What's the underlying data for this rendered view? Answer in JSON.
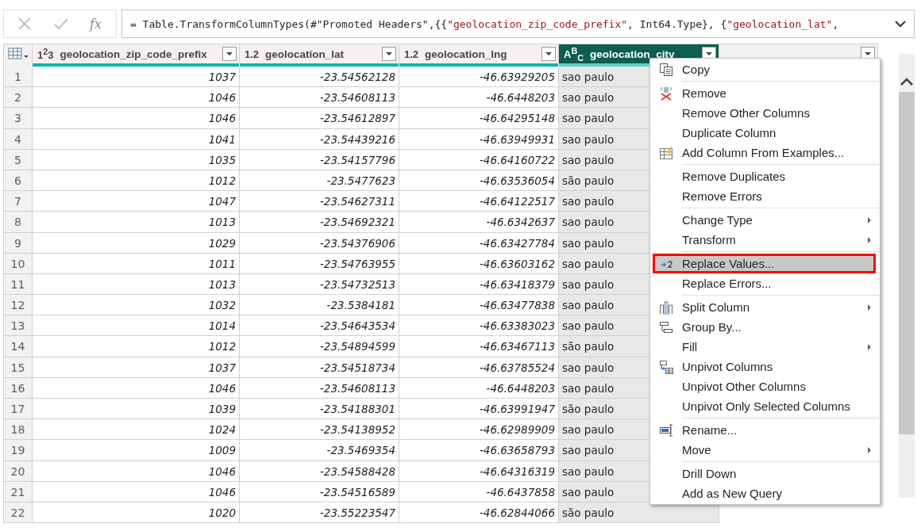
{
  "formula_bar": {
    "cancel_disabled": true,
    "commit_disabled": true,
    "fx": "fx",
    "formula": [
      {
        "kind": "code",
        "text": "= Table.TransformColumnTypes(#\"Promoted Headers\",{{"
      },
      {
        "kind": "string",
        "text": "\"geolocation_zip_code_prefix\""
      },
      {
        "kind": "code",
        "text": ", Int64.Type}, {"
      },
      {
        "kind": "string",
        "text": "\"geolocation_lat\""
      },
      {
        "kind": "code",
        "text": ","
      }
    ]
  },
  "table": {
    "columns": [
      {
        "type_label": "1$^{2}$3",
        "name": "geolocation_zip_code_prefix",
        "selected": false,
        "kind": "number"
      },
      {
        "type_label": "1.2",
        "name": "geolocation_lat",
        "selected": false,
        "kind": "number"
      },
      {
        "type_label": "1.2",
        "name": "geolocation_lng",
        "selected": false,
        "kind": "number"
      },
      {
        "type_label": "A$^{B}$$_{C}$",
        "name": "geolocation_city",
        "selected": true,
        "kind": "text"
      }
    ],
    "rows": [
      {
        "number": "1",
        "cells": [
          "1037",
          "-23.54562128",
          "-46.63929205",
          "sao paulo"
        ]
      },
      {
        "number": "2",
        "cells": [
          "1046",
          "-23.54608113",
          "-46.6448203",
          "sao paulo"
        ]
      },
      {
        "number": "3",
        "cells": [
          "1046",
          "-23.54612897",
          "-46.64295148",
          "sao paulo"
        ]
      },
      {
        "number": "4",
        "cells": [
          "1041",
          "-23.54439216",
          "-46.63949931",
          "sao paulo"
        ]
      },
      {
        "number": "5",
        "cells": [
          "1035",
          "-23.54157796",
          "-46.64160722",
          "sao paulo"
        ]
      },
      {
        "number": "6",
        "cells": [
          "1012",
          "-23.5477623",
          "-46.63536054",
          "são paulo"
        ]
      },
      {
        "number": "7",
        "cells": [
          "1047",
          "-23.54627311",
          "-46.64122517",
          "sao paulo"
        ]
      },
      {
        "number": "8",
        "cells": [
          "1013",
          "-23.54692321",
          "-46.6342637",
          "sao paulo"
        ]
      },
      {
        "number": "9",
        "cells": [
          "1029",
          "-23.54376906",
          "-46.63427784",
          "sao paulo"
        ]
      },
      {
        "number": "10",
        "cells": [
          "1011",
          "-23.54763955",
          "-46.63603162",
          "sao paulo"
        ]
      },
      {
        "number": "11",
        "cells": [
          "1013",
          "-23.54732513",
          "-46.63418379",
          "sao paulo"
        ]
      },
      {
        "number": "12",
        "cells": [
          "1032",
          "-23.5384181",
          "-46.63477838",
          "sao paulo"
        ]
      },
      {
        "number": "13",
        "cells": [
          "1014",
          "-23.54643534",
          "-46.63383023",
          "sao paulo"
        ]
      },
      {
        "number": "14",
        "cells": [
          "1012",
          "-23.54894599",
          "-46.63467113",
          "são paulo"
        ]
      },
      {
        "number": "15",
        "cells": [
          "1037",
          "-23.54518734",
          "-46.63785524",
          "sao paulo"
        ]
      },
      {
        "number": "16",
        "cells": [
          "1046",
          "-23.54608113",
          "-46.6448203",
          "sao paulo"
        ]
      },
      {
        "number": "17",
        "cells": [
          "1039",
          "-23.54188301",
          "-46.63991947",
          "são paulo"
        ]
      },
      {
        "number": "18",
        "cells": [
          "1024",
          "-23.54138952",
          "-46.62989909",
          "sao paulo"
        ]
      },
      {
        "number": "19",
        "cells": [
          "1009",
          "-23.5469354",
          "-46.63658793",
          "sao paulo"
        ]
      },
      {
        "number": "20",
        "cells": [
          "1046",
          "-23.54588428",
          "-46.64316319",
          "sao paulo"
        ]
      },
      {
        "number": "21",
        "cells": [
          "1046",
          "-23.54516589",
          "-46.6437858",
          "sao paulo"
        ]
      },
      {
        "number": "22",
        "cells": [
          "1020",
          "-23.55223547",
          "-46.62844066",
          "são paulo"
        ]
      }
    ]
  },
  "context_menu": {
    "groups": [
      [
        {
          "label": "Copy",
          "submenu": false,
          "selected": false
        }
      ],
      [
        {
          "label": "Remove",
          "submenu": false,
          "selected": false
        },
        {
          "label": "Remove Other Columns",
          "submenu": false,
          "selected": false
        },
        {
          "label": "Duplicate Column",
          "submenu": false,
          "selected": false
        },
        {
          "label": "Add Column From Examples...",
          "submenu": false,
          "selected": false
        }
      ],
      [
        {
          "label": "Remove Duplicates",
          "submenu": false,
          "selected": false
        },
        {
          "label": "Remove Errors",
          "submenu": false,
          "selected": false
        }
      ],
      [
        {
          "label": "Change Type",
          "submenu": true,
          "selected": false
        },
        {
          "label": "Transform",
          "submenu": true,
          "selected": false
        }
      ],
      [
        {
          "label": "Replace Values...",
          "submenu": false,
          "selected": true
        },
        {
          "label": "Replace Errors...",
          "submenu": false,
          "selected": false
        }
      ],
      [
        {
          "label": "Split Column",
          "submenu": true,
          "selected": false
        },
        {
          "label": "Group By...",
          "submenu": false,
          "selected": false
        },
        {
          "label": "Fill",
          "submenu": true,
          "selected": false
        },
        {
          "label": "Unpivot Columns",
          "submenu": false,
          "selected": false
        },
        {
          "label": "Unpivot Other Columns",
          "submenu": false,
          "selected": false
        },
        {
          "label": "Unpivot Only Selected Columns",
          "submenu": false,
          "selected": false
        }
      ],
      [
        {
          "label": "Rename...",
          "submenu": false,
          "selected": false
        },
        {
          "label": "Move",
          "submenu": true,
          "selected": false
        }
      ],
      [
        {
          "label": "Drill Down",
          "submenu": false,
          "selected": false
        },
        {
          "label": "Add as New Query",
          "submenu": false,
          "selected": false
        }
      ]
    ]
  }
}
